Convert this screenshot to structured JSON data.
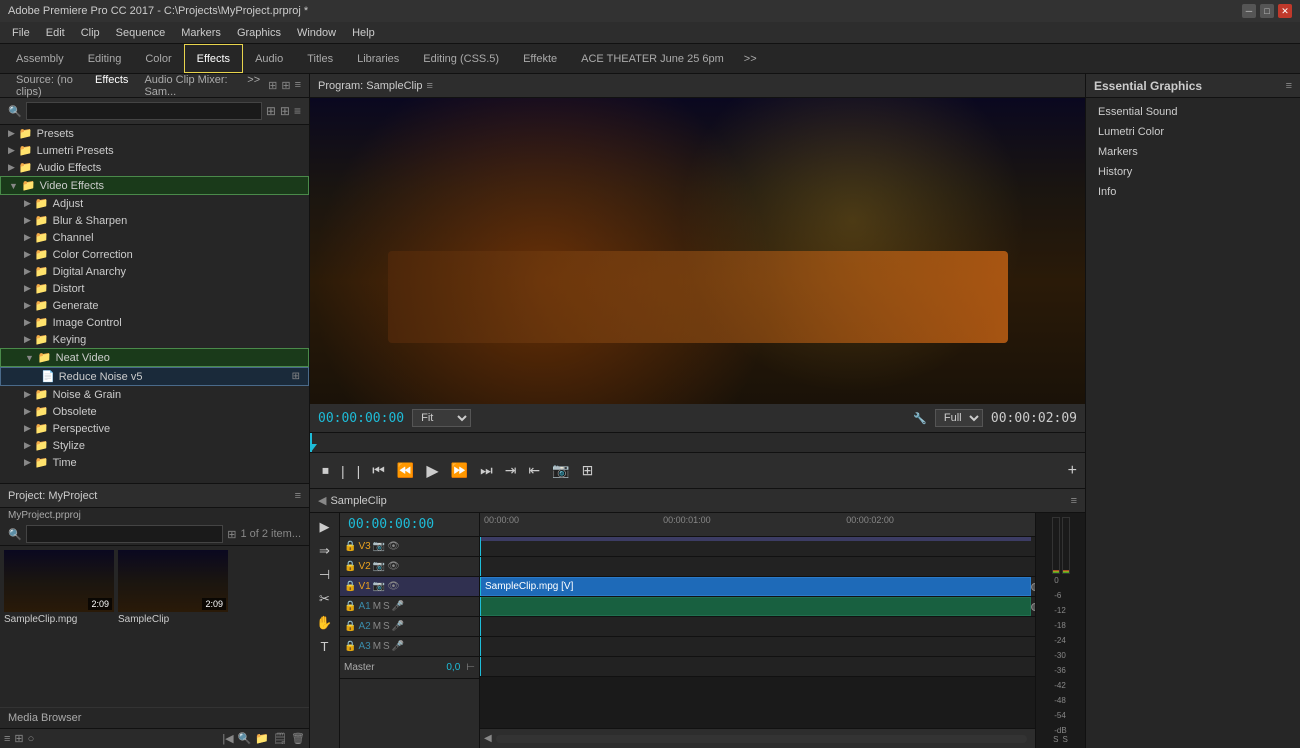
{
  "titlebar": {
    "title": "Adobe Premiere Pro CC 2017 - C:\\Projects\\MyProject.prproj *",
    "minimize": "─",
    "maximize": "□",
    "close": "✕"
  },
  "menubar": {
    "items": [
      "File",
      "Edit",
      "Clip",
      "Sequence",
      "Markers",
      "Graphics",
      "Window",
      "Help"
    ]
  },
  "workspace_tabs": {
    "tabs": [
      "Assembly",
      "Editing",
      "Color",
      "Effects",
      "Audio",
      "Titles",
      "Libraries",
      "Editing (CSS.5)",
      "Effekte",
      "ACE THEATER June 25 6pm"
    ],
    "active": "Effects",
    "overflow": ">>"
  },
  "effects_panel": {
    "tab1": "Source: (no clips)",
    "tab2": "Effects",
    "tab3": "Audio Clip Mixer: Sam...",
    "overflow": ">>",
    "search_placeholder": "",
    "icon1": "⊞",
    "icon2": "⊞",
    "icon3": "≡",
    "categories": [
      {
        "label": "Presets",
        "type": "folder",
        "expanded": false
      },
      {
        "label": "Lumetri Presets",
        "type": "folder",
        "expanded": false
      },
      {
        "label": "Audio Effects",
        "type": "folder",
        "expanded": false
      },
      {
        "label": "Video Effects",
        "type": "folder",
        "expanded": true,
        "highlighted": true
      },
      {
        "label": "Adjust",
        "type": "subfolder",
        "indent": 1
      },
      {
        "label": "Blur & Sharpen",
        "type": "subfolder",
        "indent": 1
      },
      {
        "label": "Channel",
        "type": "subfolder",
        "indent": 1
      },
      {
        "label": "Color Correction",
        "type": "subfolder",
        "indent": 1
      },
      {
        "label": "Digital Anarchy",
        "type": "subfolder",
        "indent": 1
      },
      {
        "label": "Distort",
        "type": "subfolder",
        "indent": 1
      },
      {
        "label": "Generate",
        "type": "subfolder",
        "indent": 1
      },
      {
        "label": "Image Control",
        "type": "subfolder",
        "indent": 1
      },
      {
        "label": "Keying",
        "type": "subfolder",
        "indent": 1
      },
      {
        "label": "Neat Video",
        "type": "subfolder",
        "indent": 1,
        "highlighted": true,
        "expanded": true
      },
      {
        "label": "Reduce Noise v5",
        "type": "item",
        "indent": 2,
        "highlighted": true
      },
      {
        "label": "Noise & Grain",
        "type": "subfolder",
        "indent": 1
      },
      {
        "label": "Obsolete",
        "type": "subfolder",
        "indent": 1
      },
      {
        "label": "Perspective",
        "type": "subfolder",
        "indent": 1
      },
      {
        "label": "Stylize",
        "type": "subfolder",
        "indent": 1
      },
      {
        "label": "Time",
        "type": "subfolder",
        "indent": 1
      }
    ]
  },
  "project_panel": {
    "title": "Project: MyProject",
    "project_file": "MyProject.prproj",
    "items_count": "1 of 2 item...",
    "thumbnails": [
      {
        "label": "SampleClip.mpg",
        "duration": "2:09"
      },
      {
        "label": "SampleClip",
        "duration": "2:09"
      }
    ],
    "media_browser": "Media Browser"
  },
  "program_monitor": {
    "title": "Program: SampleClip",
    "timecode_left": "00:00:00:00",
    "fit_label": "Fit",
    "quality_label": "Full",
    "timecode_right": "00:00:02:09",
    "controls": [
      "⏹",
      "|",
      "|",
      "⏮",
      "⏪",
      "▶",
      "⏩",
      "⏭",
      "⇥",
      "⇤",
      "📷",
      "⊞"
    ],
    "add_btn": "+"
  },
  "timeline_panel": {
    "title": "SampleClip",
    "timecode": "00:00:00:00",
    "ruler_marks": [
      "00:00:00",
      "00:00:01:00",
      "00:00:02:00"
    ],
    "tracks": [
      {
        "label": "V3",
        "type": "video"
      },
      {
        "label": "V2",
        "type": "video"
      },
      {
        "label": "V1",
        "type": "video",
        "active": true
      },
      {
        "label": "A1",
        "type": "audio"
      },
      {
        "label": "A2",
        "type": "audio"
      },
      {
        "label": "A3",
        "type": "audio"
      },
      {
        "label": "Master",
        "type": "master",
        "value": "0,0"
      }
    ],
    "clips": [
      {
        "track": "V1",
        "label": "SampleClip.mpg [V]",
        "start": 0,
        "type": "video"
      },
      {
        "track": "A1",
        "label": "",
        "start": 0,
        "type": "audio"
      }
    ]
  },
  "essential_graphics": {
    "title": "Essential Graphics",
    "items": [
      "Essential Sound",
      "Lumetri Color",
      "Markers",
      "History",
      "Info"
    ]
  },
  "audio_meters": {
    "labels": [
      "0",
      "-6",
      "-12",
      "-18",
      "-24",
      "-30",
      "-36",
      "-42",
      "-48",
      "-54",
      "-dB"
    ],
    "s_labels": [
      "S",
      "S"
    ]
  }
}
